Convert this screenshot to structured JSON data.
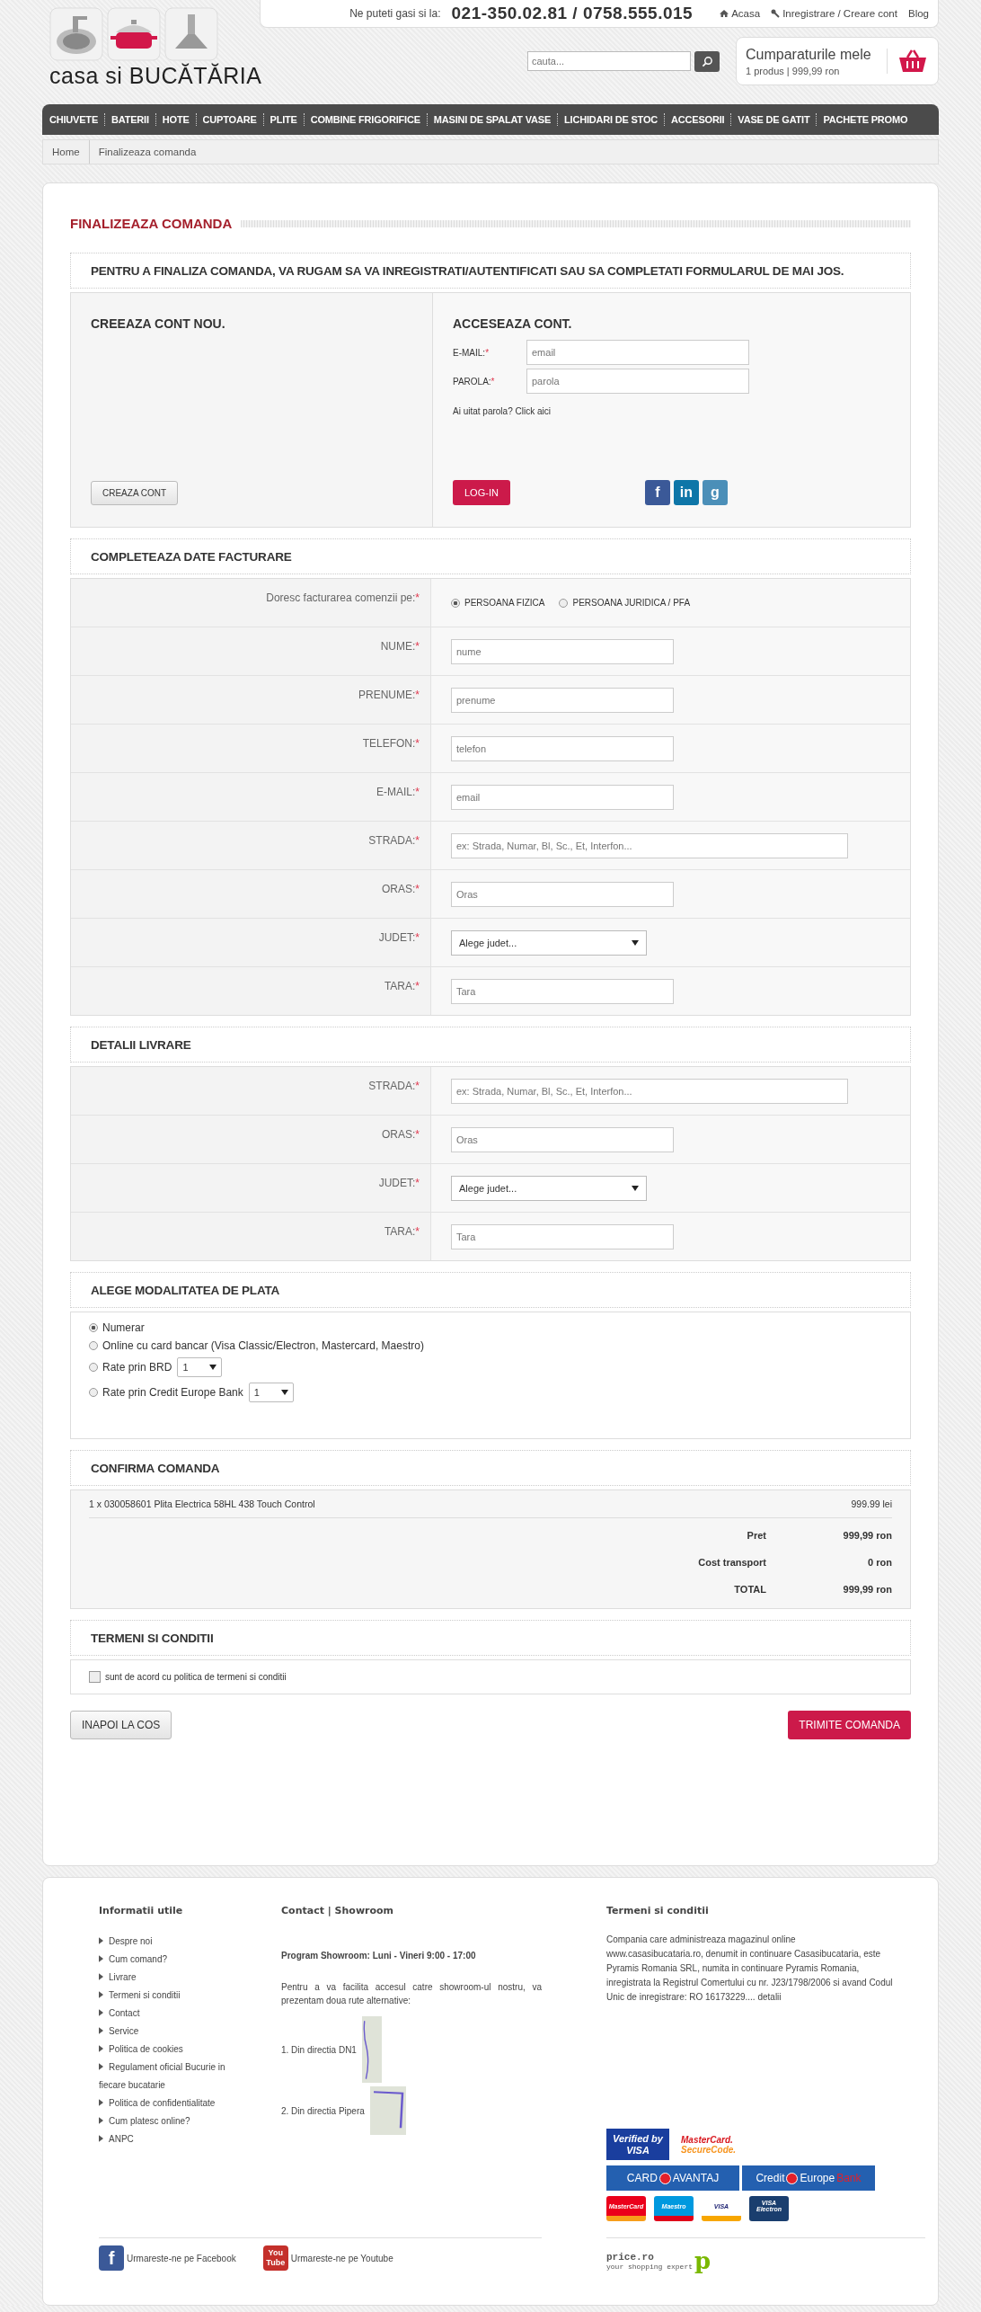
{
  "header": {
    "logo_text": "casa si BUCĂTĂRIA",
    "contact_label": "Ne puteti gasi si la:",
    "phone": "021-350.02.81 / 0758.555.015",
    "links": [
      {
        "label": "Acasa",
        "kind": "home"
      },
      {
        "label": "Inregistrare / Creare cont",
        "kind": "account"
      },
      {
        "label": "Blog",
        "kind": "plain"
      }
    ],
    "search": {
      "placeholder": "cauta..."
    },
    "cart": {
      "title": "Cumparaturile mele",
      "summary": "1 produs | 999,99 ron"
    }
  },
  "nav": [
    "CHIUVETE",
    "BATERII",
    "HOTE",
    "CUPTOARE",
    "PLITE",
    "COMBINE FRIGORIFICE",
    "MASINI DE SPALAT VASE",
    "LICHIDARI DE STOC",
    "ACCESORII",
    "VASE DE GATIT",
    "PACHETE PROMO"
  ],
  "breadcrumb": [
    "Home",
    "Finalizeaza comanda"
  ],
  "page_title": "FINALIZEAZA COMANDA",
  "account": {
    "notice": "PENTRU A FINALIZA COMANDA, VA RUGAM SA VA INREGISTRATI/AUTENTIFICATI SAU SA COMPLETATI FORMULARUL DE MAI JOS.",
    "create_title": "CREEAZA CONT NOU.",
    "create_button": "CREAZA CONT",
    "login_title": "ACCESEAZA CONT.",
    "fields": [
      {
        "label": "E-MAIL:",
        "required": "*",
        "placeholder": "email"
      },
      {
        "label": "PAROLA:",
        "required": "*",
        "placeholder": "parola"
      }
    ],
    "forgot": "Ai uitat parola? Click aici",
    "login_button": "LOG-IN",
    "social": [
      {
        "kind": "facebook",
        "glyph": "f"
      },
      {
        "kind": "linkedin",
        "glyph": "in"
      },
      {
        "kind": "google",
        "glyph": "g"
      }
    ]
  },
  "billing": {
    "title": "COMPLETEAZA DATE FACTURARE",
    "rows": [
      {
        "kind": "radio",
        "label": "Doresc facturarea comenzii pe:",
        "required": "*",
        "options": [
          {
            "label": "PERSOANA FIZICA",
            "selected": true
          },
          {
            "label": "PERSOANA JURIDICA / PFA",
            "selected": false
          }
        ]
      },
      {
        "kind": "text",
        "label": "NUME:",
        "required": "*",
        "placeholder": "nume"
      },
      {
        "kind": "text",
        "label": "PRENUME:",
        "required": "*",
        "placeholder": "prenume"
      },
      {
        "kind": "text",
        "label": "TELEFON:",
        "required": "*",
        "placeholder": "telefon"
      },
      {
        "kind": "text",
        "label": "E-MAIL:",
        "required": "*",
        "placeholder": "email"
      },
      {
        "kind": "long_text",
        "label": "STRADA:",
        "required": "*",
        "placeholder": "ex: Strada, Numar, Bl, Sc., Et, Interfon..."
      },
      {
        "kind": "text",
        "label": "ORAS:",
        "required": "*",
        "placeholder": "Oras"
      },
      {
        "kind": "select",
        "label": "JUDET:",
        "required": "*",
        "value": "Alege judet..."
      },
      {
        "kind": "text",
        "label": "TARA:",
        "required": "*",
        "placeholder": "Tara"
      }
    ]
  },
  "delivery": {
    "title": "DETALII LIVRARE",
    "rows": [
      {
        "kind": "long_text",
        "label": "STRADA:",
        "required": "*",
        "placeholder": "ex: Strada, Numar, Bl, Sc., Et, Interfon..."
      },
      {
        "kind": "text",
        "label": "ORAS:",
        "required": "*",
        "placeholder": "Oras"
      },
      {
        "kind": "select",
        "label": "JUDET:",
        "required": "*",
        "value": "Alege judet..."
      },
      {
        "kind": "text",
        "label": "TARA:",
        "required": "*",
        "placeholder": "Tara"
      }
    ]
  },
  "payment": {
    "title": "ALEGE MODALITATEA DE PLATA",
    "options": [
      {
        "label": "Numerar",
        "selected": true
      },
      {
        "label": "Online cu card bancar (Visa Classic/Electron, Mastercard, Maestro)",
        "selected": false
      },
      {
        "label": "Rate prin BRD",
        "selected": false,
        "installments": "1"
      },
      {
        "label": "Rate prin Credit Europe Bank",
        "selected": false,
        "installments": "1"
      }
    ]
  },
  "confirm": {
    "title": "CONFIRMA COMANDA",
    "item": "1 x 030058601 Plita Electrica 58HL 438 Touch Control",
    "item_price": "999.99 lei",
    "totals": [
      {
        "label": "Pret",
        "value": "999,99 ron"
      },
      {
        "label": "Cost transport",
        "value": "0 ron"
      },
      {
        "label": "TOTAL",
        "value": "999,99 ron"
      }
    ]
  },
  "terms": {
    "title": "TERMENI SI CONDITII",
    "checkbox": {
      "label": "sunt de acord cu politica de termeni si conditii",
      "checked": false
    }
  },
  "actions": {
    "back": "INAPOI LA COS",
    "submit": "TRIMITE COMANDA"
  },
  "footer": {
    "info_title": "Informatii utile",
    "links": [
      "Despre noi",
      "Cum comand?",
      "Livrare",
      "Termeni si conditii",
      "Contact",
      "Service",
      "Politica de cookies",
      "Regulament oficial Bucurie in fiecare bucatarie",
      "Politica de confidentialitate",
      "Cum platesc online?",
      "ANPC"
    ],
    "contact_title": "Contact | Showroom",
    "program": "Program Showroom: Luni - Vineri 9:00 - 17:00",
    "intro": "Pentru a va facilita accesul catre showroom-ul nostru, va prezentam doua rute alternative:",
    "routes": [
      "1. Din directia DN1",
      "2. Din directia Pipera"
    ],
    "terms_title": "Termeni si conditii",
    "terms_text": "Compania care administreaza magazinul online www.casasibucataria.ro, denumit in continuare Casasibucataria, este Pyramis Romania SRL, numita in continuare Pyramis Romania, inregistrata la Registrul Comertului cu nr. J23/1798/2006 si avand Codul Unic de inregistrare: RO 16173229....",
    "terms_link": "detalii",
    "secure_logos": [
      {
        "kind": "visa_verified",
        "lines": [
          "Verified by",
          "VISA"
        ]
      },
      {
        "kind": "mc_secure",
        "lines": [
          "MasterCard.",
          "SecureCode."
        ]
      }
    ],
    "bank_logos": [
      {
        "parts": [
          "CARD",
          "AVANTAJ"
        ]
      },
      {
        "parts": [
          "Credit",
          "Europe",
          "Bank"
        ]
      }
    ],
    "card_logos": [
      {
        "kind": "mastercard",
        "lines": [
          "MasterCard"
        ]
      },
      {
        "kind": "maestro",
        "lines": [
          "Maestro"
        ]
      },
      {
        "kind": "visa",
        "lines": [
          "VISA"
        ]
      },
      {
        "kind": "visa_electron",
        "lines": [
          "VISA",
          "Electron"
        ]
      }
    ],
    "social": [
      {
        "kind": "facebook",
        "icon_text": [
          "f"
        ],
        "label": "Urmareste-ne pe Facebook"
      },
      {
        "kind": "youtube",
        "icon_text": [
          "You",
          "Tube"
        ],
        "label": "Urmareste-ne pe Youtube"
      }
    ],
    "partner": {
      "name": "price.ro",
      "tagline": "your shopping expert",
      "glyph": "p"
    }
  }
}
